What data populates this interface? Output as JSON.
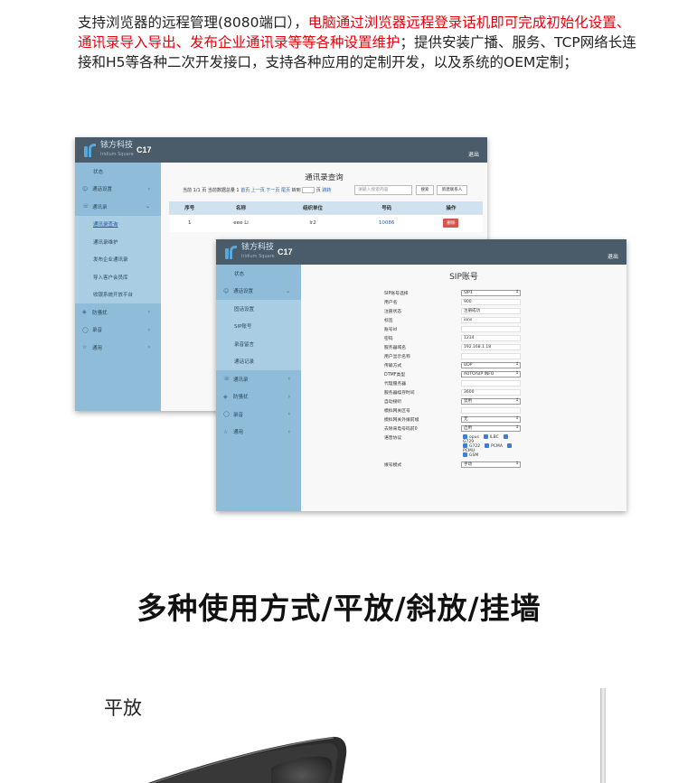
{
  "intro": {
    "part1": "支持浏览器的远程管理(8080端口），",
    "part_red": "电脑通过浏览器远程登录话机即可完成初始化设置、通讯录导入导出、发布企业通讯录等等各种设置维护",
    "part2": "；提供安装广播、服务、TCP网络长连接和H5等各种二次开发接口，支持各种应用的定制开发，以及系统的OEM定制；"
  },
  "app": {
    "logo_cn": "铱方科技",
    "logo_en": "Iridium Square",
    "model": "C17",
    "logout": "退出"
  },
  "win1": {
    "sidebar": {
      "status": "状态",
      "call_settings": "通话设置",
      "phonebook": "通讯录",
      "sub": [
        "通讯录查询",
        "通讯录维护",
        "发布企业通讯录",
        "导入客户会员库",
        "收银系统开放平台"
      ],
      "anti_harass": "防骚扰",
      "recording": "录音",
      "general": "通用"
    },
    "title": "通讯录查询",
    "pager": {
      "prefix": "当前 1/1 页 当前数据总量 1",
      "links": "首页 上一页 下一页 尾页",
      "goto": "转到",
      "page": "页",
      "jump": "跳转"
    },
    "search_placeholder": "请输入搜索内容",
    "search_btn": "搜索",
    "add_btn": "新建联系人",
    "columns": [
      "序号",
      "名称",
      "组织单位",
      "号码",
      "操作"
    ],
    "rows": [
      {
        "idx": "1",
        "name": "eee Li",
        "org": "lr2",
        "number": "10086",
        "op": "删除"
      }
    ]
  },
  "win2": {
    "sidebar": {
      "status": "状态",
      "call_settings": "通话设置",
      "sub": [
        "固话设置",
        "SIP账号",
        "录音留言",
        "通话记录"
      ],
      "phonebook": "通讯录",
      "anti_harass": "防骚扰",
      "recording": "录音",
      "general": "通用"
    },
    "title": "SIP账号",
    "fields": [
      {
        "label": "SIP账号选择",
        "value": "SIP1",
        "type": "select"
      },
      {
        "label": "用户名",
        "value": "900",
        "type": "text"
      },
      {
        "label": "注册状态",
        "value": "注册成功",
        "type": "text"
      },
      {
        "label": "标签",
        "value": "ions",
        "type": "text"
      },
      {
        "label": "账号id",
        "value": "",
        "type": "text"
      },
      {
        "label": "密码",
        "value": "1234",
        "type": "text"
      },
      {
        "label": "服务器域名",
        "value": "192.168.1.18",
        "type": "text"
      },
      {
        "label": "用户显示名称",
        "value": "",
        "type": "text"
      },
      {
        "label": "传输方式",
        "value": "UDP",
        "type": "select"
      },
      {
        "label": "DTMF类型",
        "value": "AUTO/SIP INFO",
        "type": "select"
      },
      {
        "label": "代理服务器",
        "value": "",
        "type": "text"
      },
      {
        "label": "服务器续存时间",
        "value": "3600",
        "type": "text"
      },
      {
        "label": "自动接听",
        "value": "禁用",
        "type": "select"
      },
      {
        "label": "模拟网关区号",
        "value": "",
        "type": "text"
      },
      {
        "label": "模拟网关外拨前缀",
        "value": "无",
        "type": "select"
      },
      {
        "label": "去除来电号码前0",
        "value": "启用",
        "type": "select"
      }
    ],
    "codec_label": "语音协议",
    "codecs_row1": [
      "opus",
      "ILBC",
      "G729"
    ],
    "codecs_row2": [
      "G722",
      "PCMA",
      "PCMU"
    ],
    "codecs_row3": [
      "GSM"
    ],
    "dial_mode_label": "拨号模式",
    "dial_mode_value": "手动"
  },
  "heading": "多种使用方式/平放/斜放/挂墙",
  "flat_label": "平放"
}
